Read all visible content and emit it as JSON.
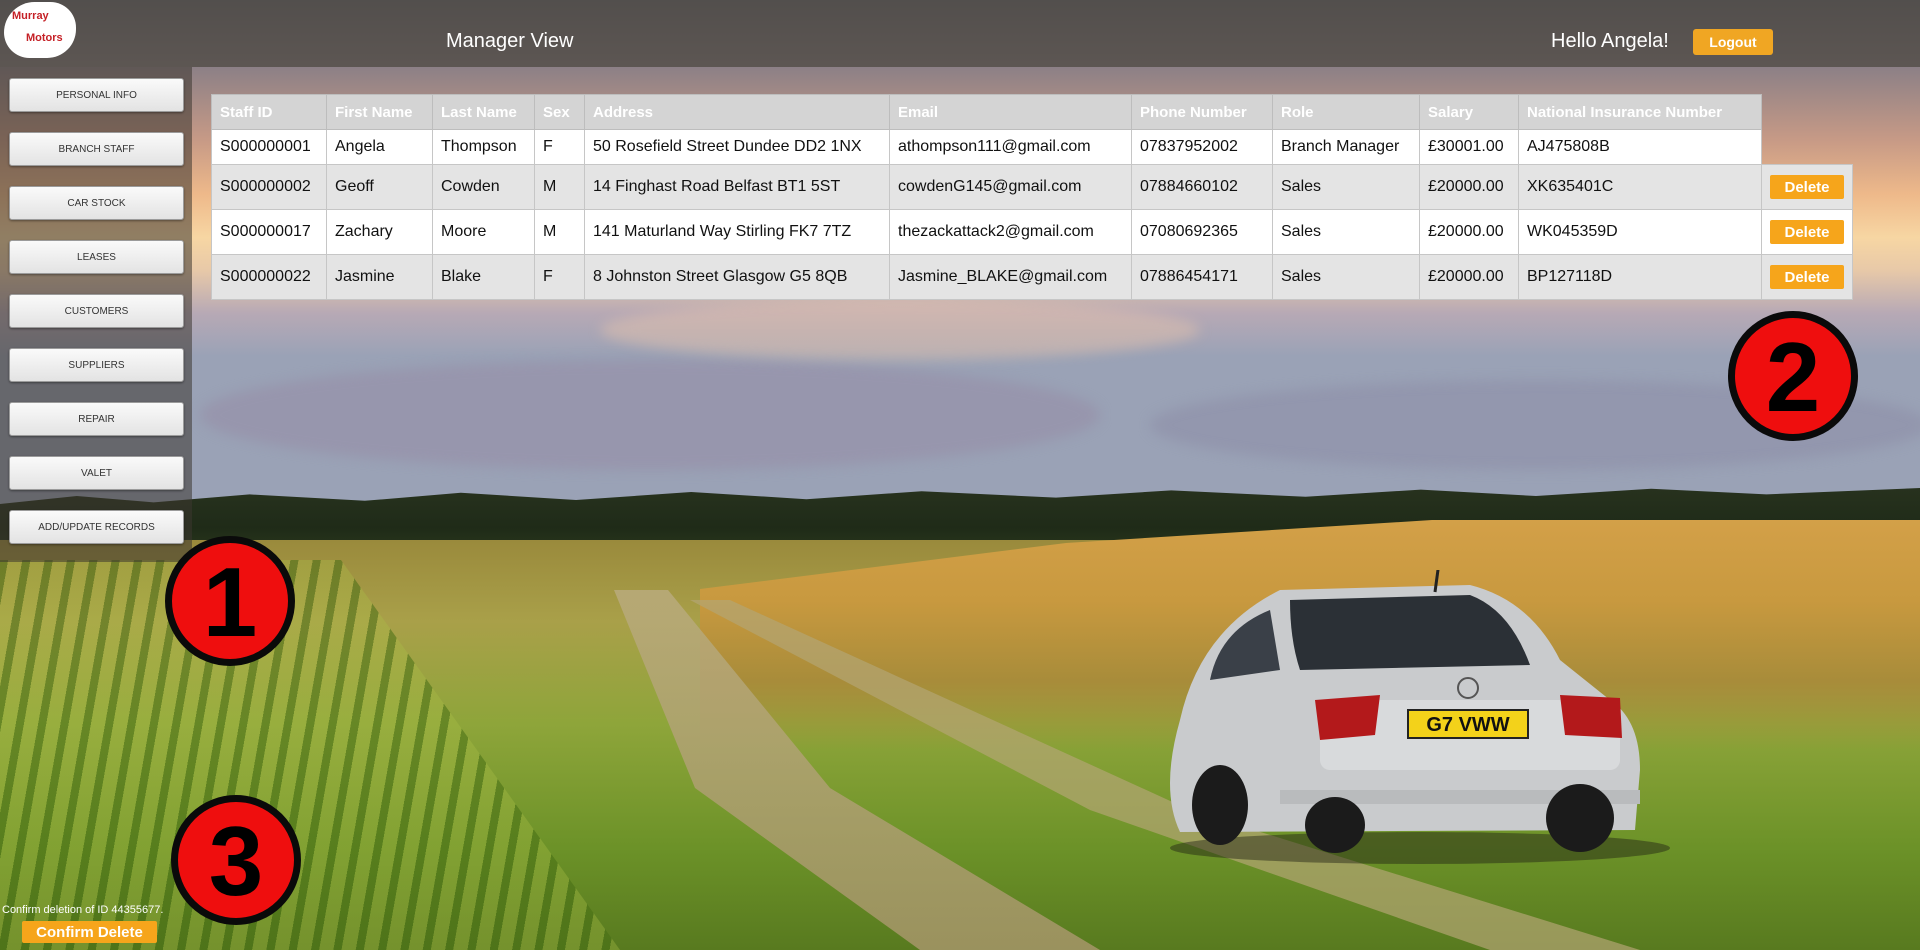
{
  "header": {
    "logo_line1": "Murray",
    "logo_line2": "Motors",
    "title": "Manager View",
    "greeting": "Hello Angela!",
    "logout_label": "Logout"
  },
  "sidebar": {
    "items": [
      {
        "label": "PERSONAL INFO"
      },
      {
        "label": "BRANCH STAFF"
      },
      {
        "label": "CAR STOCK"
      },
      {
        "label": "LEASES"
      },
      {
        "label": "CUSTOMERS"
      },
      {
        "label": "SUPPLIERS"
      },
      {
        "label": "REPAIR"
      },
      {
        "label": "VALET"
      },
      {
        "label": "ADD/UPDATE RECORDS"
      }
    ]
  },
  "table": {
    "columns": [
      "Staff ID",
      "First Name",
      "Last Name",
      "Sex",
      "Address",
      "Email",
      "Phone Number",
      "Role",
      "Salary",
      "National Insurance Number"
    ],
    "delete_label": "Delete",
    "rows": [
      [
        "S000000001",
        "Angela",
        "Thompson",
        "F",
        "50 Rosefield Street Dundee DD2 1NX",
        "athompson111@gmail.com",
        "07837952002",
        "Branch Manager",
        "£30001.00",
        "AJ475808B"
      ],
      [
        "S000000002",
        "Geoff",
        "Cowden",
        "M",
        "14 Finghast Road Belfast BT1 5ST",
        "cowdenG145@gmail.com",
        "07884660102",
        "Sales",
        "£20000.00",
        "XK635401C"
      ],
      [
        "S000000017",
        "Zachary",
        "Moore",
        "M",
        "141 Maturland Way Stirling FK7 7TZ",
        "thezackattack2@gmail.com",
        "07080692365",
        "Sales",
        "£20000.00",
        "WK045359D"
      ],
      [
        "S000000022",
        "Jasmine",
        "Blake",
        "F",
        "8 Johnston Street Glasgow G5 8QB",
        "Jasmine_BLAKE@gmail.com",
        "07886454171",
        "Sales",
        "£20000.00",
        "BP127118D"
      ]
    ]
  },
  "markers": [
    "1",
    "2",
    "3"
  ],
  "confirm": {
    "text": "Confirm deletion of ID 44355677.",
    "button_label": "Confirm Delete"
  },
  "car": {
    "plate": "G7 VWW"
  }
}
